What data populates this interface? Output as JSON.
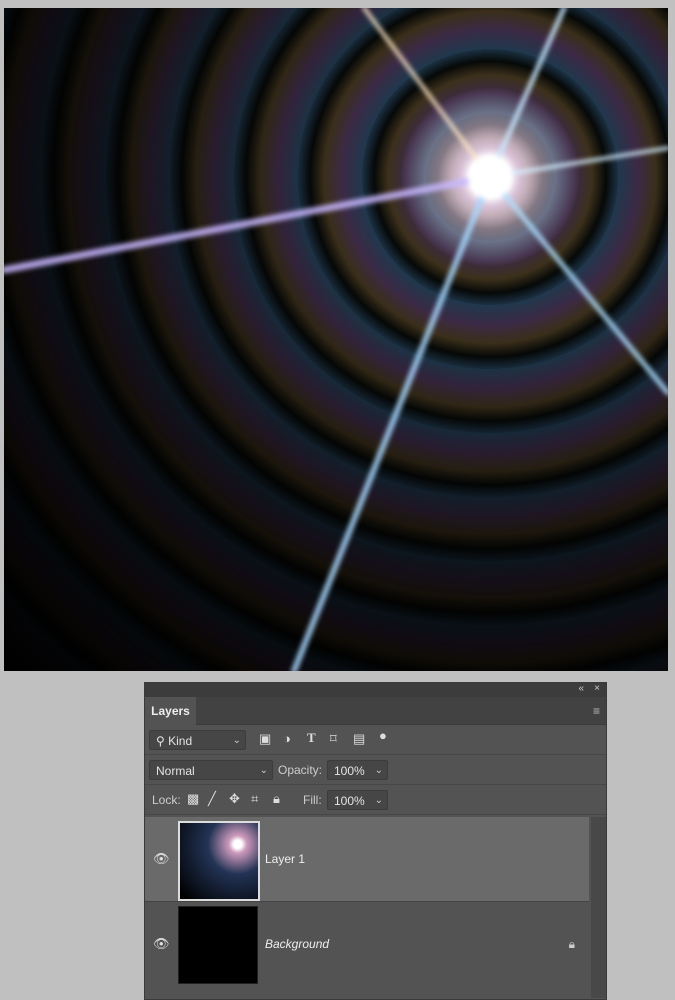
{
  "panel": {
    "title": "Layers",
    "filter": "Kind",
    "blend_mode": "Normal",
    "opacity_label": "Opacity:",
    "opacity": "100%",
    "lock_label": "Lock:",
    "fill_label": "Fill:",
    "fill": "100%"
  },
  "layers": [
    {
      "name": "Layer 1",
      "visible": true,
      "selected": true
    },
    {
      "name": "Background",
      "visible": true,
      "locked": true
    }
  ],
  "icons": {
    "collapse": "«",
    "close": "×",
    "menu": "≡"
  }
}
